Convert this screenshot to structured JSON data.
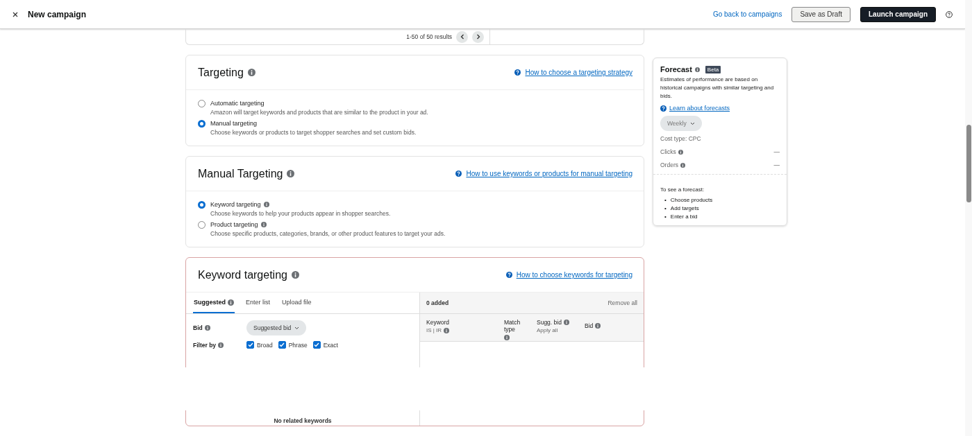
{
  "header": {
    "title": "New campaign",
    "back_link": "Go back to campaigns",
    "draft_button": "Save as Draft",
    "launch_button": "Launch campaign"
  },
  "results": {
    "text": "1-50 of 50 results"
  },
  "targeting": {
    "title": "Targeting",
    "help_link": "How to choose a targeting strategy",
    "options": [
      {
        "label": "Automatic targeting",
        "description": "Amazon will target keywords and products that are similar to the product in your ad.",
        "selected": false,
        "info": false
      },
      {
        "label": "Manual targeting",
        "description": "Choose keywords or products to target shopper searches and set custom bids.",
        "selected": true,
        "info": false
      }
    ]
  },
  "manual_targeting": {
    "title": "Manual Targeting",
    "help_link": "How to use keywords or products for manual targeting",
    "options": [
      {
        "label": "Keyword targeting",
        "description": "Choose keywords to help your products appear in shopper searches.",
        "selected": true,
        "info": true
      },
      {
        "label": "Product targeting",
        "description": "Choose specific products, categories, brands, or other product features to target your ads.",
        "selected": false,
        "info": true
      }
    ]
  },
  "keyword_targeting": {
    "title": "Keyword targeting",
    "help_link": "How to choose keywords for targeting",
    "tabs": [
      {
        "label": "Suggested",
        "selected": true,
        "info": true
      },
      {
        "label": "Enter list",
        "selected": false,
        "info": false
      },
      {
        "label": "Upload file",
        "selected": false,
        "info": false
      }
    ],
    "bid": {
      "label": "Bid",
      "value": "Suggested bid"
    },
    "filter": {
      "label": "Filter by",
      "options": [
        {
          "label": "Broad",
          "checked": true
        },
        {
          "label": "Phrase",
          "checked": true
        },
        {
          "label": "Exact",
          "checked": true
        }
      ]
    },
    "empty_text": "No related keywords",
    "added": "0 added",
    "remove_all": "Remove all",
    "columns": [
      {
        "title": "Keyword",
        "title_info": false,
        "subtitle": "IS | IR",
        "subtitle_info": true
      },
      {
        "title": "Match type",
        "title_info": true
      },
      {
        "title": "Sugg. bid",
        "title_info": true,
        "subtitle": "Apply all",
        "subtitle_info": false
      },
      {
        "title": "Bid",
        "title_info": true
      }
    ]
  },
  "forecast": {
    "title": "Forecast",
    "badge": "Beta",
    "description": "Estimates of performance are based on historical campaigns with similar targeting and bids.",
    "link": "Learn about forecasts",
    "period": "Weekly",
    "cost_type": "Cost type: CPC",
    "metrics": [
      {
        "label": "Clicks",
        "value": "—"
      },
      {
        "label": "Orders",
        "value": "—"
      }
    ],
    "hint": "To see a forecast:",
    "steps": [
      {
        "marker": "•",
        "text": "Choose products"
      },
      {
        "marker": "•",
        "text": "Add targets"
      },
      {
        "marker": "•",
        "text": "Enter a bid"
      }
    ]
  }
}
